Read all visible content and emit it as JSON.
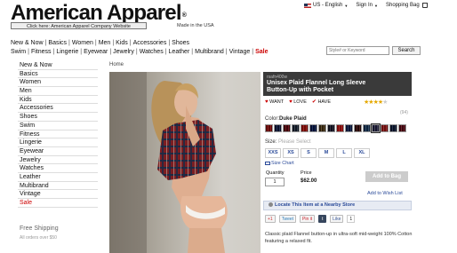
{
  "brand": {
    "name": "American Apparel",
    "registered": "®",
    "tagline_button": "Click here: American Apparel Company Website",
    "made_in": "Made in the USA"
  },
  "utility": {
    "locale": "US - English",
    "sign_in": "Sign In",
    "bag": "Shopping Bag"
  },
  "nav_row1": [
    "New & Now",
    "Basics",
    "Women",
    "Men",
    "Kids",
    "Accessories",
    "Shoes"
  ],
  "nav_row2": [
    "Swim",
    "Fitness",
    "Lingerie",
    "Eyewear",
    "Jewelry",
    "Watches",
    "Leather",
    "Multibrand",
    "Vintage",
    "Sale"
  ],
  "search": {
    "placeholder": "Style# or Keyword",
    "button": "Search"
  },
  "sidebar": {
    "items": [
      "New & Now",
      "Basics",
      "Women",
      "Men",
      "Kids",
      "Accessories",
      "Shoes",
      "Swim",
      "Fitness",
      "Lingerie",
      "Eyewear",
      "Jewelry",
      "Watches",
      "Leather",
      "Multibrand",
      "Vintage",
      "Sale"
    ],
    "free_shipping": "Free Shipping",
    "orders_over": "All orders over $50"
  },
  "breadcrumb": "Home",
  "product": {
    "sku": "rsafn400w",
    "title_line1": "Unisex Plaid Flannel Long Sleeve",
    "title_line2": "Button-Up with Pocket",
    "actions": {
      "want": "WANT",
      "love": "LOVE",
      "have": "HAVE"
    },
    "rating": 4,
    "rating_max": 5,
    "review_count": "(94)",
    "color_prefix": "Color:",
    "color_name": "Duke Plaid",
    "swatch_colors": [
      "#9a2a2a",
      "#2f3d66",
      "#7a1f2b",
      "#3d4a5c",
      "#a8322c",
      "#233a6e",
      "#6b5a3a",
      "#3b3b52",
      "#b23030",
      "#2c4170",
      "#5a2a2a",
      "#3a5a7a",
      "#4a4a6a",
      "#a33b3b",
      "#2e3e5e",
      "#7a2a3a"
    ],
    "selected_swatch": 12,
    "size_prefix": "Size:",
    "size_placeholder": "Please Select",
    "sizes": [
      "XXS",
      "XS",
      "S",
      "M",
      "L",
      "XL"
    ],
    "size_chart": "Size Chart",
    "quantity_label": "Quantity",
    "quantity": "1",
    "price_label": "Price",
    "price": "$62.00",
    "add_to_bag": "Add to Bag",
    "wish_list": "Add to Wish List",
    "locate": "Locate This Item at a Nearby Store",
    "description": "Classic plaid Flannel button-up in ultra-soft mid-weight 100% Cotton featuring a relaxed fit."
  },
  "social": {
    "gplus": "+1",
    "tweet": "Tweet",
    "pin": "Pin it",
    "tumblr": "t",
    "like": "Like",
    "like_count": "1"
  },
  "colors": {
    "sale_red": "#cc0000",
    "link_blue": "#2a4a99",
    "title_bar": "#3a3a3a"
  }
}
